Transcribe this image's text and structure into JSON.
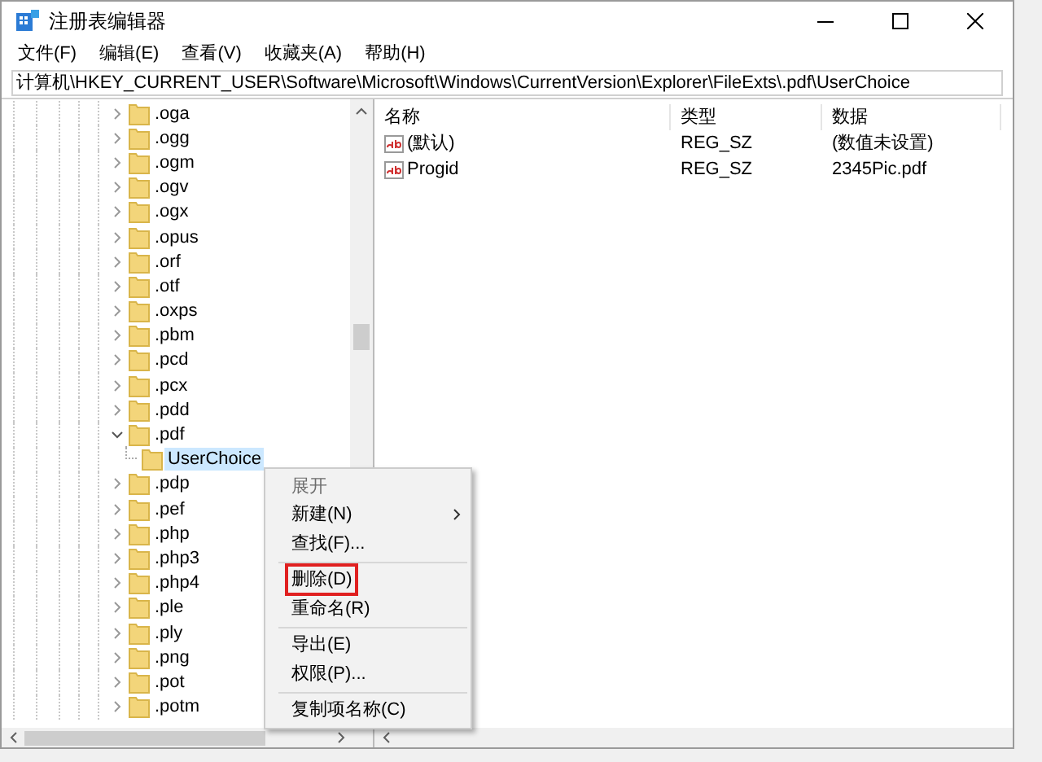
{
  "window": {
    "title": "注册表编辑器"
  },
  "menu": [
    "文件(F)",
    "编辑(E)",
    "查看(V)",
    "收藏夹(A)",
    "帮助(H)"
  ],
  "address": "计算机\\HKEY_CURRENT_USER\\Software\\Microsoft\\Windows\\CurrentVersion\\Explorer\\FileExts\\.pdf\\UserChoice",
  "tree": [
    {
      "label": ".oga",
      "expanded": false,
      "selected": false
    },
    {
      "label": ".ogg",
      "expanded": false,
      "selected": false
    },
    {
      "label": ".ogm",
      "expanded": false,
      "selected": false
    },
    {
      "label": ".ogv",
      "expanded": false,
      "selected": false
    },
    {
      "label": ".ogx",
      "expanded": false,
      "selected": false
    },
    {
      "label": ".opus",
      "expanded": false,
      "selected": false
    },
    {
      "label": ".orf",
      "expanded": false,
      "selected": false
    },
    {
      "label": ".otf",
      "expanded": false,
      "selected": false
    },
    {
      "label": ".oxps",
      "expanded": false,
      "selected": false
    },
    {
      "label": ".pbm",
      "expanded": false,
      "selected": false
    },
    {
      "label": ".pcd",
      "expanded": false,
      "selected": false
    },
    {
      "label": ".pcx",
      "expanded": false,
      "selected": false
    },
    {
      "label": ".pdd",
      "expanded": false,
      "selected": false
    },
    {
      "label": ".pdf",
      "expanded": true,
      "selected": false,
      "children": [
        {
          "label": "UserChoice",
          "selected": true
        }
      ]
    },
    {
      "label": ".pdp",
      "expanded": false,
      "selected": false
    },
    {
      "label": ".pef",
      "expanded": false,
      "selected": false
    },
    {
      "label": ".php",
      "expanded": false,
      "selected": false
    },
    {
      "label": ".php3",
      "expanded": false,
      "selected": false
    },
    {
      "label": ".php4",
      "expanded": false,
      "selected": false
    },
    {
      "label": ".ple",
      "expanded": false,
      "selected": false
    },
    {
      "label": ".ply",
      "expanded": false,
      "selected": false
    },
    {
      "label": ".png",
      "expanded": false,
      "selected": false
    },
    {
      "label": ".pot",
      "expanded": false,
      "selected": false
    },
    {
      "label": ".potm",
      "expanded": false,
      "selected": false
    }
  ],
  "table": {
    "columns": [
      "名称",
      "类型",
      "数据"
    ],
    "rows": [
      {
        "name": "(默认)",
        "type": "REG_SZ",
        "data": "(数值未设置)"
      },
      {
        "name": "Progid",
        "type": "REG_SZ",
        "data": "2345Pic.pdf"
      }
    ]
  },
  "context_menu": [
    {
      "kind": "item",
      "label": "展开",
      "disabled": true,
      "submenu": false,
      "highlighted": false
    },
    {
      "kind": "item",
      "label": "新建(N)",
      "disabled": false,
      "submenu": true,
      "highlighted": false
    },
    {
      "kind": "item",
      "label": "查找(F)...",
      "disabled": false,
      "submenu": false,
      "highlighted": false
    },
    {
      "kind": "separator"
    },
    {
      "kind": "item",
      "label": "删除(D)",
      "disabled": false,
      "submenu": false,
      "highlighted": true
    },
    {
      "kind": "item",
      "label": "重命名(R)",
      "disabled": false,
      "submenu": false,
      "highlighted": false
    },
    {
      "kind": "separator"
    },
    {
      "kind": "item",
      "label": "导出(E)",
      "disabled": false,
      "submenu": false,
      "highlighted": false
    },
    {
      "kind": "item",
      "label": "权限(P)...",
      "disabled": false,
      "submenu": false,
      "highlighted": false
    },
    {
      "kind": "separator"
    },
    {
      "kind": "item",
      "label": "复制项名称(C)",
      "disabled": false,
      "submenu": false,
      "highlighted": false
    }
  ]
}
